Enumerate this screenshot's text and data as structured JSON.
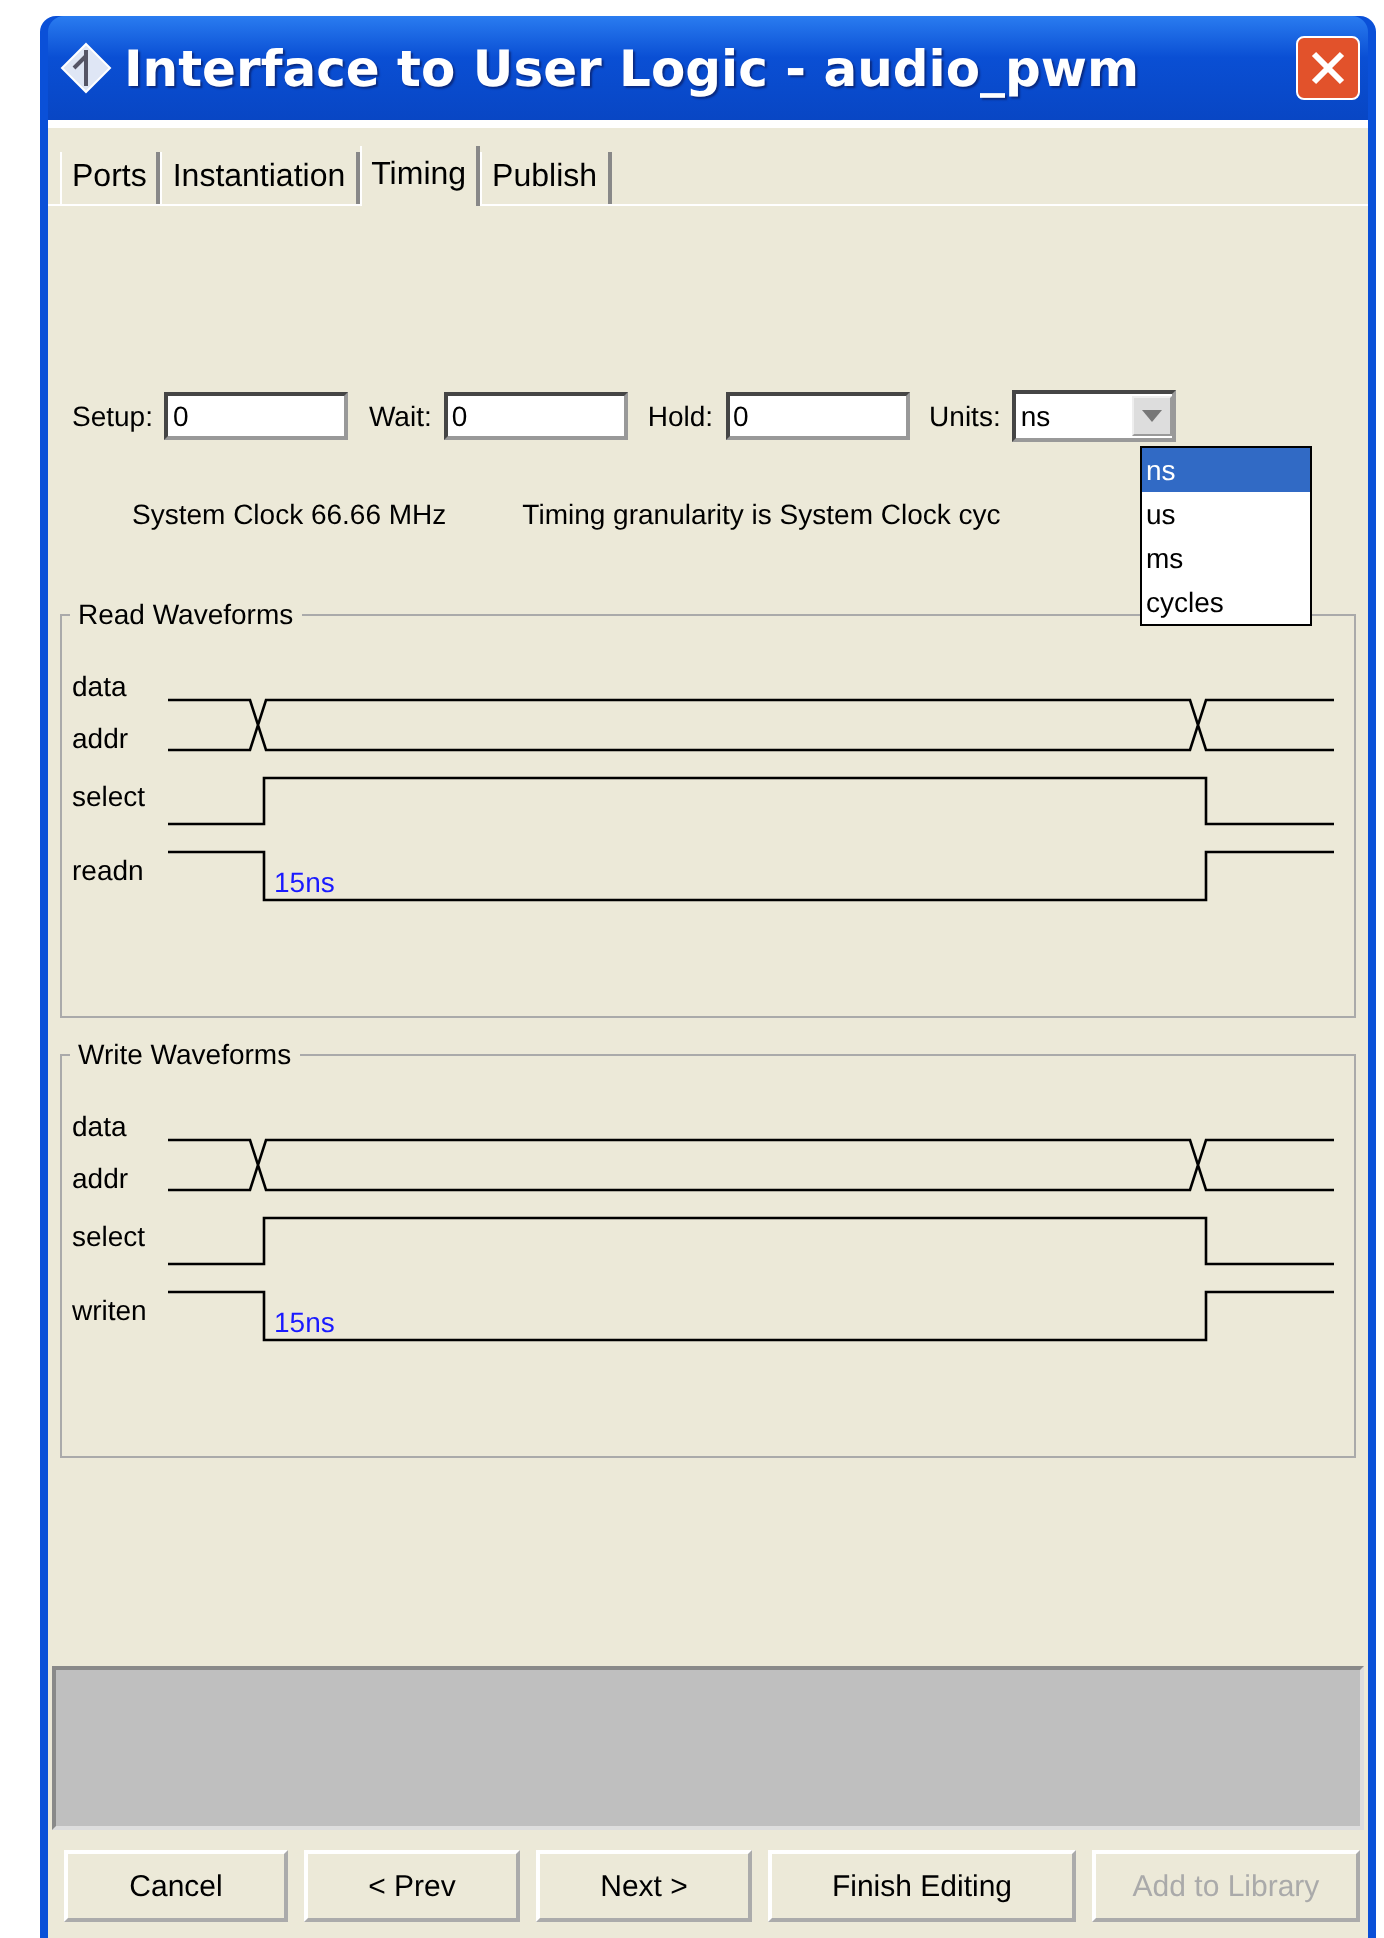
{
  "window": {
    "title": "Interface to User Logic - audio_pwm"
  },
  "tabs": [
    {
      "label": "Ports",
      "selected": false
    },
    {
      "label": "Instantiation",
      "selected": false
    },
    {
      "label": "Timing",
      "selected": true
    },
    {
      "label": "Publish",
      "selected": false
    }
  ],
  "timing_fields": [
    {
      "label": "Setup:",
      "value": "0"
    },
    {
      "label": "Wait:",
      "value": "0"
    },
    {
      "label": "Hold:",
      "value": "0"
    }
  ],
  "units": {
    "label": "Units:",
    "value": "ns",
    "options": [
      {
        "label": "ns",
        "selected": true
      },
      {
        "label": "us",
        "selected": false
      },
      {
        "label": "ms",
        "selected": false
      },
      {
        "label": "cycles",
        "selected": false
      }
    ]
  },
  "info": [
    "System Clock 66.66 MHz",
    "Timing granularity is System Clock cyc"
  ],
  "panels": [
    {
      "title": "Read Waveforms",
      "signals": [
        "data",
        "addr",
        "select",
        "readn"
      ],
      "delay": "15ns"
    },
    {
      "title": "Write Waveforms",
      "signals": [
        "data",
        "addr",
        "select",
        "writen"
      ],
      "delay": "15ns"
    }
  ],
  "buttons": [
    {
      "label": "Cancel",
      "disabled": false
    },
    {
      "label": "< Prev",
      "disabled": false
    },
    {
      "label": "Next >",
      "disabled": false
    },
    {
      "label": "Finish Editing",
      "disabled": false
    },
    {
      "label": "Add to Library",
      "disabled": true
    }
  ]
}
